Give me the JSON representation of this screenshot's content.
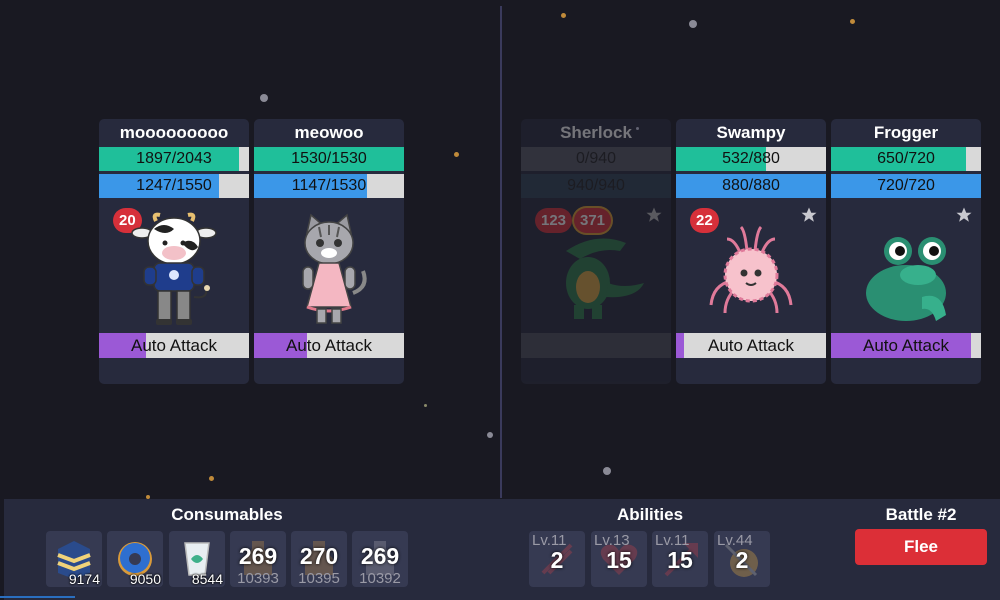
{
  "allies": [
    {
      "name": "mooooooooo",
      "hp": "1897/2043",
      "hp_frac": 0.93,
      "mp": "1247/1550",
      "mp_frac": 0.8,
      "action": "Auto Attack",
      "action_frac": 0.31,
      "badge": "20",
      "portrait": "cow-person-icon"
    },
    {
      "name": "meowoo",
      "hp": "1530/1530",
      "hp_frac": 1.0,
      "mp": "1147/1530",
      "mp_frac": 0.75,
      "action": "Auto Attack",
      "action_frac": 0.35,
      "portrait": "cat-person-icon"
    }
  ],
  "enemies": [
    {
      "name": "Sherlock",
      "hp": "0/940",
      "hp_frac": 0.0,
      "mp": "940/940",
      "mp_frac": 1.0,
      "action": "",
      "action_frac": 0,
      "badge": "123",
      "badge2": "371",
      "portrait": "crocodile-icon",
      "dead": true
    },
    {
      "name": "Swampy",
      "hp": "532/880",
      "hp_frac": 0.6,
      "mp": "880/880",
      "mp_frac": 1.0,
      "action": "Auto Attack",
      "action_frac": 0.05,
      "badge": "22",
      "portrait": "spider-icon"
    },
    {
      "name": "Frogger",
      "hp": "650/720",
      "hp_frac": 0.9,
      "mp": "720/720",
      "mp_frac": 1.0,
      "action": "Auto Attack",
      "action_frac": 0.93,
      "portrait": "frog-icon"
    }
  ],
  "consumables": {
    "title": "Consumables",
    "items": [
      {
        "icon": "cake-icon",
        "qty": "9174"
      },
      {
        "icon": "donut-icon",
        "qty": "9050"
      },
      {
        "icon": "cup-icon",
        "qty": "8544"
      },
      {
        "icon": "hp-potion-icon",
        "big": "269",
        "sub": "10393"
      },
      {
        "icon": "mp-potion-icon",
        "big": "270",
        "sub": "10395"
      },
      {
        "icon": "potion-icon",
        "big": "269",
        "sub": "10392"
      }
    ]
  },
  "abilities": {
    "title": "Abilities",
    "items": [
      {
        "icon": "slash-icon",
        "level": "Lv.11",
        "value": "2"
      },
      {
        "icon": "heart-icon",
        "level": "Lv.13",
        "value": "15"
      },
      {
        "icon": "spear-icon",
        "level": "Lv.11",
        "value": "15"
      },
      {
        "icon": "shield-icon",
        "level": "Lv.44",
        "value": "2"
      }
    ]
  },
  "battle": {
    "title": "Battle #2",
    "flee_label": "Flee"
  },
  "colors": {
    "hp": "#1fbf9a",
    "mp": "#3b97e8",
    "action": "#9b59d6",
    "flee": "#dc2f37"
  }
}
